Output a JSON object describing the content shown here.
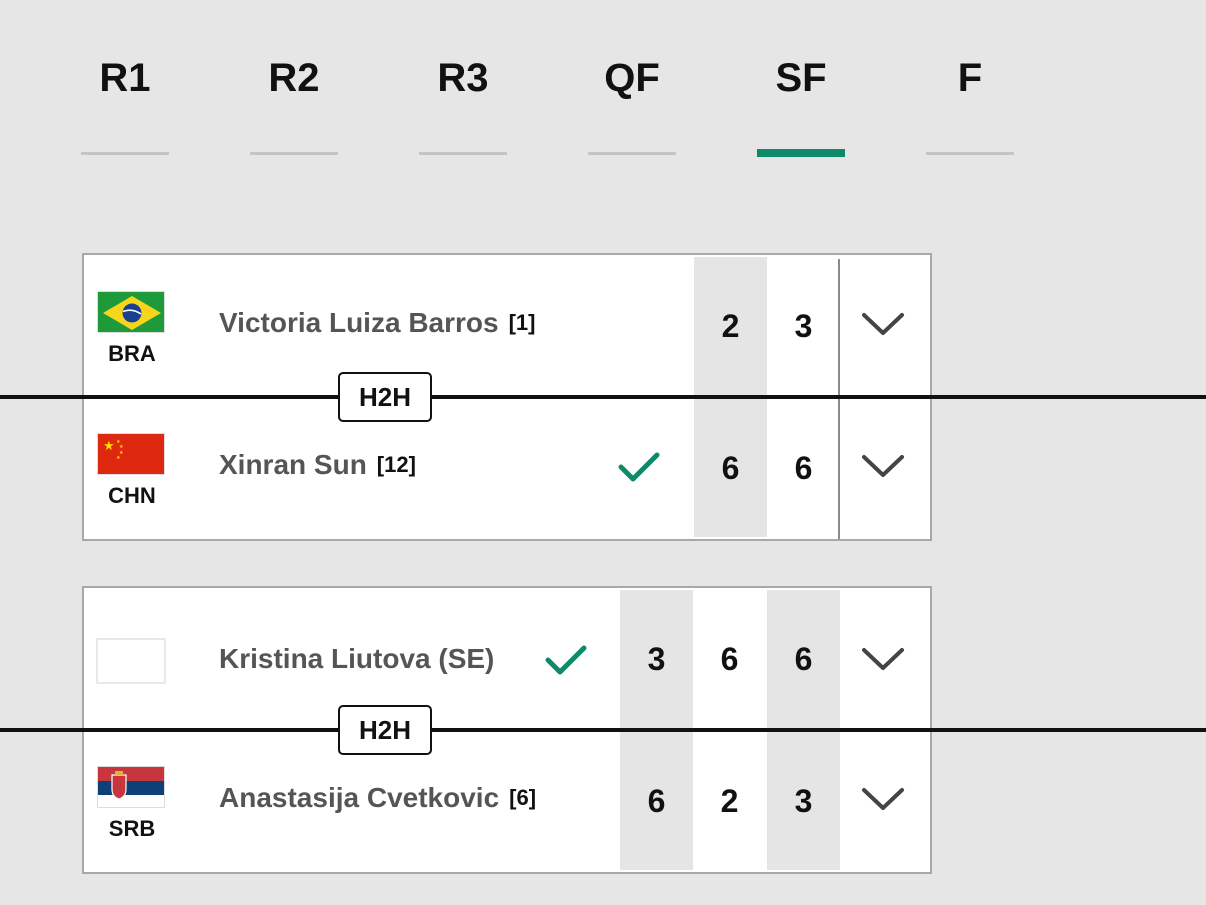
{
  "rounds": [
    {
      "label": "R1",
      "active": false
    },
    {
      "label": "R2",
      "active": false
    },
    {
      "label": "R3",
      "active": false
    },
    {
      "label": "QF",
      "active": false
    },
    {
      "label": "SF",
      "active": true
    },
    {
      "label": "F",
      "active": false
    }
  ],
  "colors": {
    "accent": "#0e8a6b",
    "inactive_underline": "#c4c4c4",
    "background": "#e6e6e6",
    "score_shade": "#e5e5e5",
    "name_text": "#555555"
  },
  "matches": [
    {
      "h2h_label": "H2H",
      "players": [
        {
          "country": "BRA",
          "flag": "brazil-flag",
          "name": "Victoria Luiza Barros",
          "seed": "[1]",
          "winner": false,
          "scores": [
            "2",
            "3"
          ]
        },
        {
          "country": "CHN",
          "flag": "china-flag",
          "name": "Xinran Sun",
          "seed": "[12]",
          "winner": true,
          "scores": [
            "6",
            "6"
          ]
        }
      ]
    },
    {
      "h2h_label": "H2H",
      "players": [
        {
          "country": "",
          "flag": "blank-flag",
          "name": "Kristina Liutova (SE)",
          "seed": "",
          "winner": true,
          "scores": [
            "3",
            "6",
            "6"
          ]
        },
        {
          "country": "SRB",
          "flag": "serbia-flag",
          "name": "Anastasija Cvetkovic",
          "seed": "[6]",
          "winner": false,
          "scores": [
            "6",
            "2",
            "3"
          ]
        }
      ]
    }
  ],
  "icons": {
    "winner": "check-icon",
    "expand": "chevron-down-icon"
  }
}
